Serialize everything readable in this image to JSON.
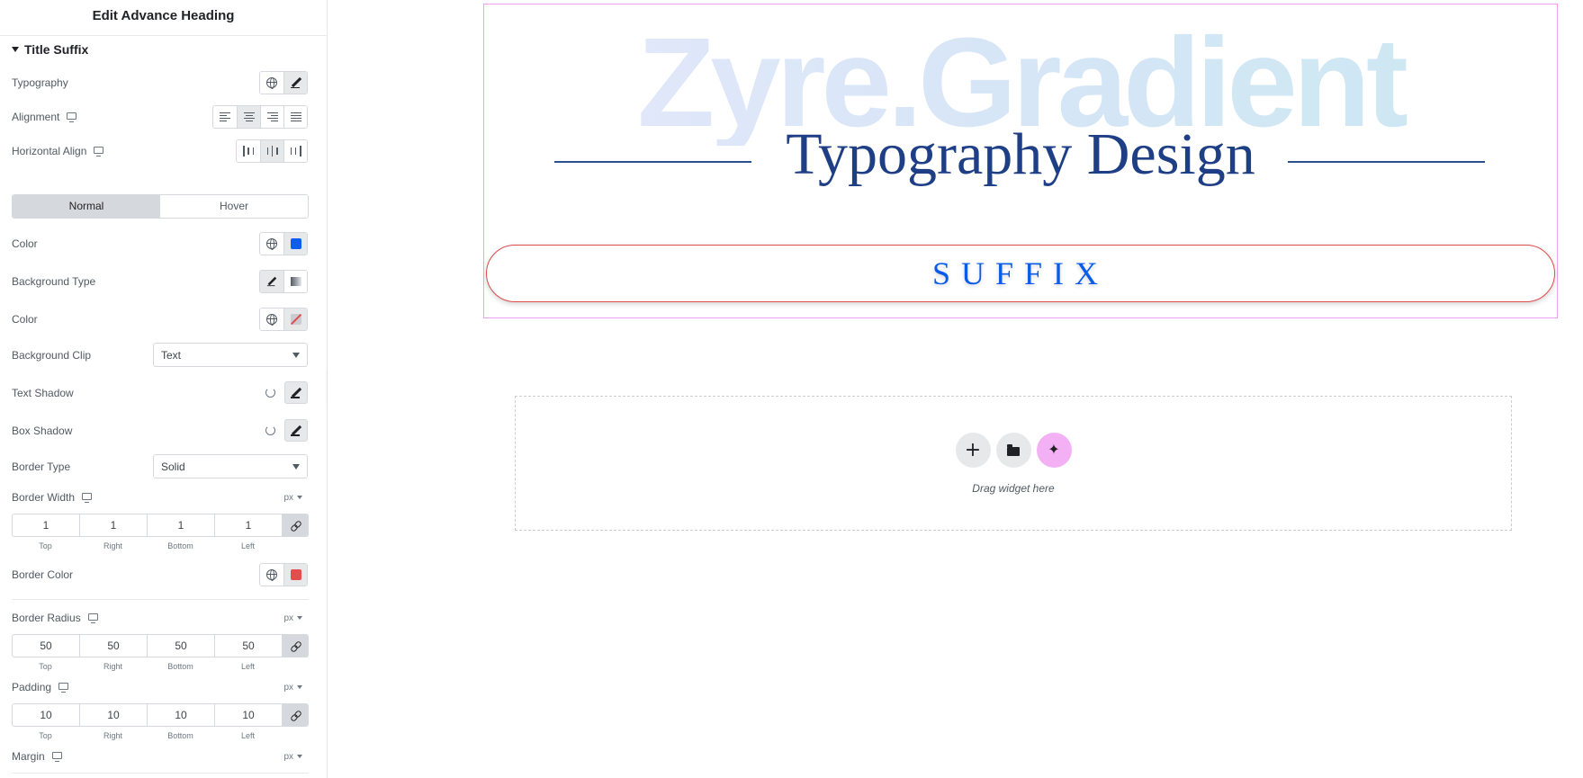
{
  "panel": {
    "title": "Edit Advance Heading",
    "section": "Title Suffix",
    "labels": {
      "typography": "Typography",
      "alignment": "Alignment",
      "horizontal_align": "Horizontal Align",
      "color": "Color",
      "background_type": "Background Type",
      "bg_color": "Color",
      "background_clip": "Background Clip",
      "text_shadow": "Text Shadow",
      "box_shadow": "Box Shadow",
      "border_type": "Border Type",
      "border_width": "Border Width",
      "border_color": "Border Color",
      "border_radius": "Border Radius",
      "padding": "Padding",
      "margin": "Margin"
    },
    "tabs": [
      "Normal",
      "Hover"
    ],
    "active_tab": "Normal",
    "background_clip_value": "Text",
    "border_type_value": "Solid",
    "unit": "px",
    "dim_labels": [
      "Top",
      "Right",
      "Bottom",
      "Left"
    ],
    "border_width": [
      "1",
      "1",
      "1",
      "1"
    ],
    "border_radius": [
      "50",
      "50",
      "50",
      "50"
    ],
    "padding": [
      "10",
      "10",
      "10",
      "10"
    ],
    "colors": {
      "text_color": "#0c5ef0",
      "border_color": "#e74c4c"
    }
  },
  "canvas": {
    "background_heading": "Zyre.Gradient",
    "main_heading": "Typography Design",
    "suffix": "SUFFIX",
    "drop_zone_text": "Drag widget here"
  }
}
